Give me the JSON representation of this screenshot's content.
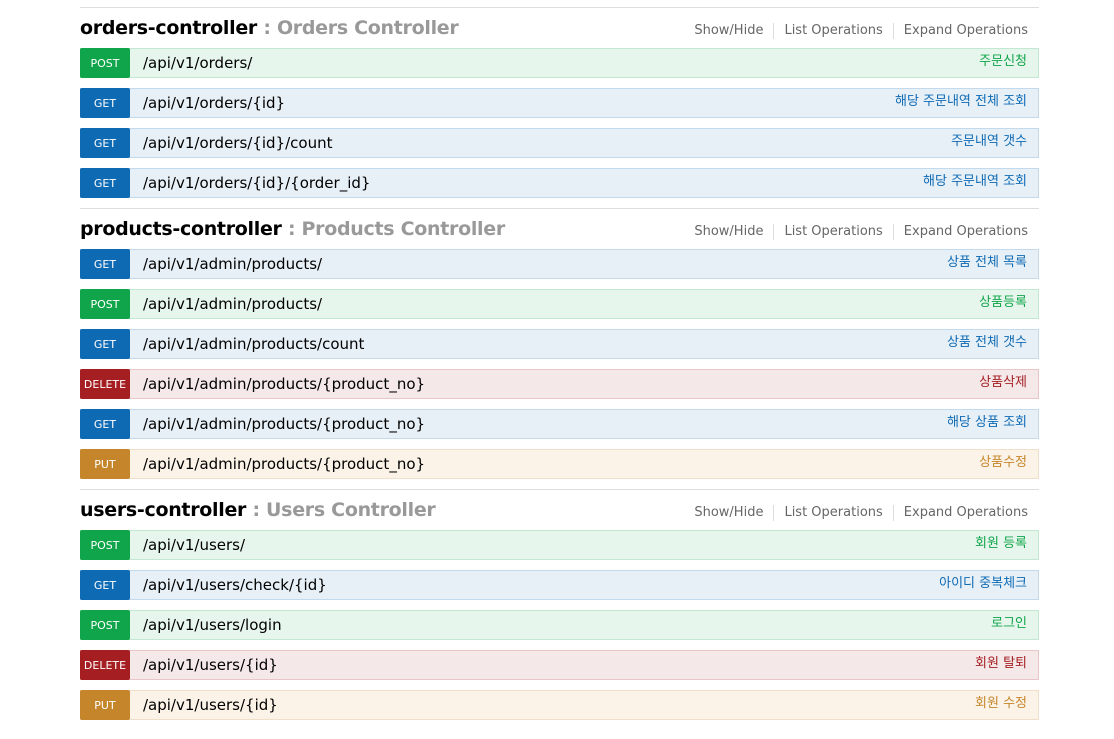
{
  "common": {
    "show_hide": "Show/Hide",
    "list_operations": "List Operations",
    "expand_operations": "Expand Operations"
  },
  "colors": {
    "post": "#10a54a",
    "get": "#0f6ab4",
    "delete": "#a41e22",
    "put": "#c5862b"
  },
  "resources": [
    {
      "name": "orders-controller",
      "description": " : Orders Controller",
      "operations": [
        {
          "method": "POST",
          "path": "/api/v1/orders/",
          "summary": "주문신청"
        },
        {
          "method": "GET",
          "path": "/api/v1/orders/{id}",
          "summary": "해당 주문내역 전체 조회"
        },
        {
          "method": "GET",
          "path": "/api/v1/orders/{id}/count",
          "summary": "주문내역 갯수"
        },
        {
          "method": "GET",
          "path": "/api/v1/orders/{id}/{order_id}",
          "summary": "해당 주문내역 조회"
        }
      ]
    },
    {
      "name": "products-controller",
      "description": " : Products Controller",
      "operations": [
        {
          "method": "GET",
          "path": "/api/v1/admin/products/",
          "summary": "상품 전체 목록"
        },
        {
          "method": "POST",
          "path": "/api/v1/admin/products/",
          "summary": "상품등록"
        },
        {
          "method": "GET",
          "path": "/api/v1/admin/products/count",
          "summary": "상품 전체 갯수"
        },
        {
          "method": "DELETE",
          "path": "/api/v1/admin/products/{product_no}",
          "summary": "상품삭제"
        },
        {
          "method": "GET",
          "path": "/api/v1/admin/products/{product_no}",
          "summary": "해당 상품 조회"
        },
        {
          "method": "PUT",
          "path": "/api/v1/admin/products/{product_no}",
          "summary": "상품수정"
        }
      ]
    },
    {
      "name": "users-controller",
      "description": " : Users Controller",
      "operations": [
        {
          "method": "POST",
          "path": "/api/v1/users/",
          "summary": "회원 등록"
        },
        {
          "method": "GET",
          "path": "/api/v1/users/check/{id}",
          "summary": "아이디 중복체크"
        },
        {
          "method": "POST",
          "path": "/api/v1/users/login",
          "summary": "로그인"
        },
        {
          "method": "DELETE",
          "path": "/api/v1/users/{id}",
          "summary": "회원 탈퇴"
        },
        {
          "method": "PUT",
          "path": "/api/v1/users/{id}",
          "summary": "회원 수정"
        }
      ]
    }
  ]
}
